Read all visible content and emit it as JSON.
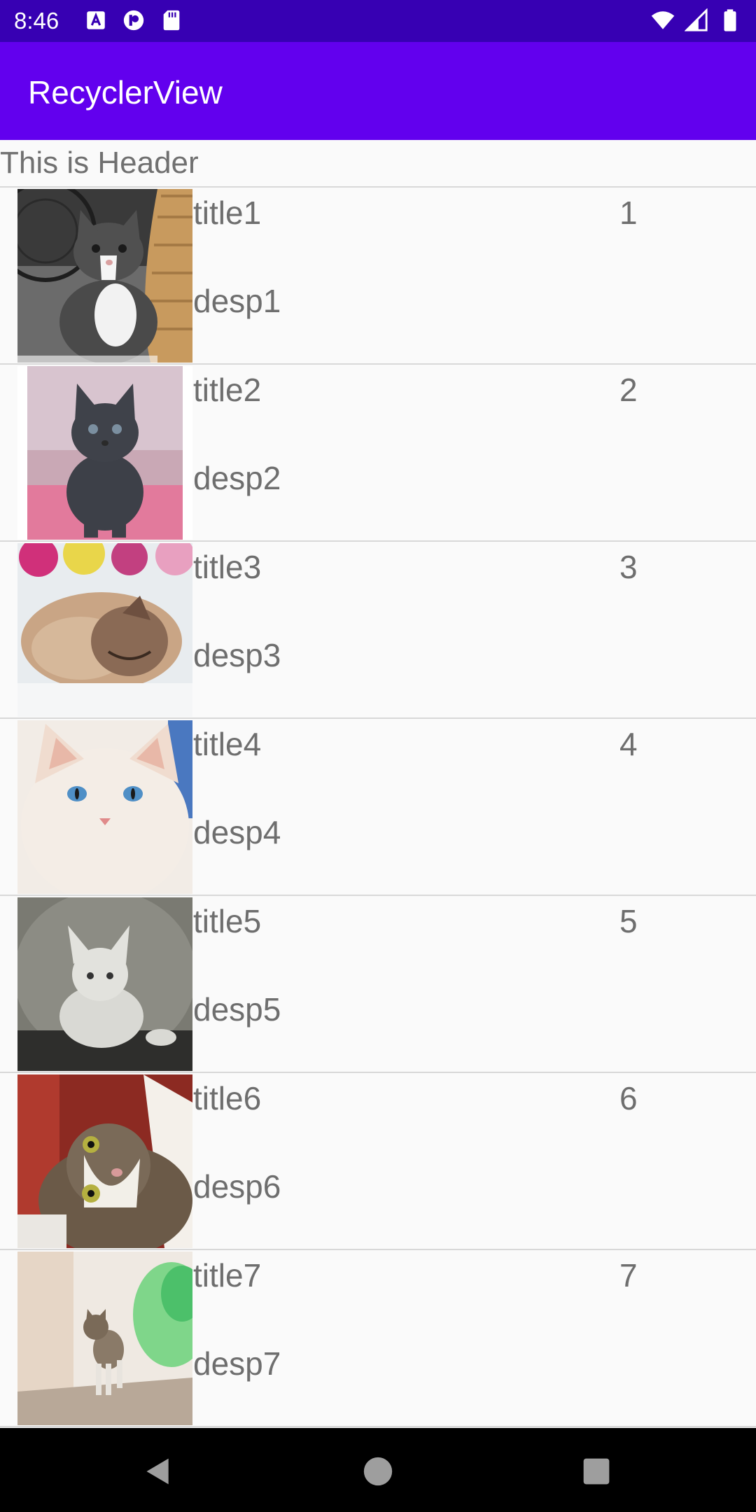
{
  "status_bar": {
    "time": "8:46",
    "icons_left": [
      "a-box-icon",
      "p-circle-icon",
      "sd-card-icon"
    ],
    "icons_right": [
      "wifi-icon",
      "signal-icon",
      "battery-icon"
    ]
  },
  "app_bar": {
    "title": "RecyclerView"
  },
  "header": {
    "label": "This is Header"
  },
  "items": [
    {
      "title": "title1",
      "desc": "desp1",
      "number": "1"
    },
    {
      "title": "title2",
      "desc": "desp2",
      "number": "2"
    },
    {
      "title": "title3",
      "desc": "desp3",
      "number": "3"
    },
    {
      "title": "title4",
      "desc": "desp4",
      "number": "4"
    },
    {
      "title": "title5",
      "desc": "desp5",
      "number": "5"
    },
    {
      "title": "title6",
      "desc": "desp6",
      "number": "6"
    },
    {
      "title": "title7",
      "desc": "desp7",
      "number": "7"
    }
  ],
  "nav_bar": {
    "buttons": [
      "back-icon",
      "home-icon",
      "recents-icon"
    ]
  },
  "colors": {
    "status_bar": "#3700b3",
    "app_bar": "#6200ee",
    "text": "#6e6e6e",
    "nav_bar": "#000000"
  }
}
